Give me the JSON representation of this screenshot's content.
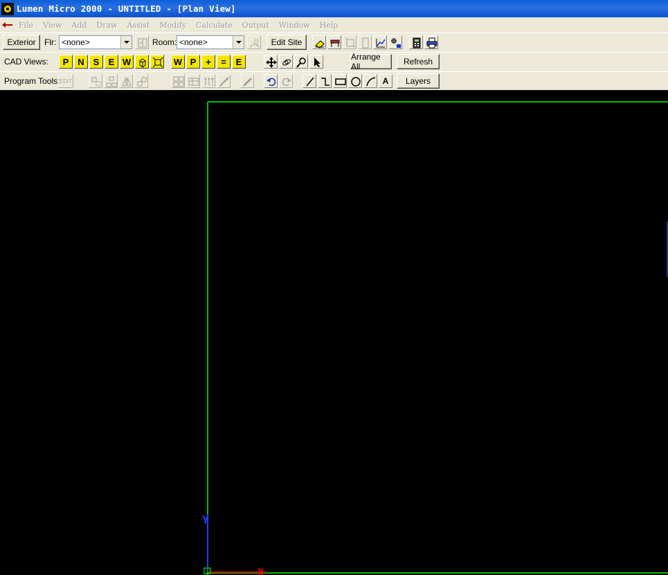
{
  "window": {
    "title": "Lumen Micro 2000 - UNTITLED - [Plan View]"
  },
  "menu": {
    "items": [
      {
        "key": "file",
        "label": "File"
      },
      {
        "key": "view",
        "label": "View"
      },
      {
        "key": "add",
        "label": "Add"
      },
      {
        "key": "draw",
        "label": "Draw"
      },
      {
        "key": "assist",
        "label": "Assist"
      },
      {
        "key": "modify",
        "label": "Modify"
      },
      {
        "key": "calculate",
        "label": "Calculate"
      },
      {
        "key": "output",
        "label": "Output"
      },
      {
        "key": "window",
        "label": "Window"
      },
      {
        "key": "help",
        "label": "Help"
      }
    ]
  },
  "row1": {
    "exterior": "Exterior",
    "floor_label": "Flr:",
    "floor_value": "<none>",
    "room_label": "Room:",
    "room_value": "<none>",
    "edit_site": "Edit Site"
  },
  "row2": {
    "label": "CAD Views:",
    "views": [
      "P",
      "N",
      "S",
      "E",
      "W"
    ],
    "tools": [
      "W",
      "P",
      "+",
      "=",
      "E"
    ],
    "arrange_all": "Arrange All",
    "refresh": "Refresh"
  },
  "row3": {
    "label": "Program Tools:",
    "edit": "EDIT",
    "text_tool": "A",
    "layers": "Layers"
  },
  "canvas": {
    "colors": {
      "background": "#000000",
      "boundary": "#00c000",
      "y_axis": "#2040ff",
      "x_axis": "#e00000"
    },
    "y_label": "Y",
    "x_label": "X"
  }
}
